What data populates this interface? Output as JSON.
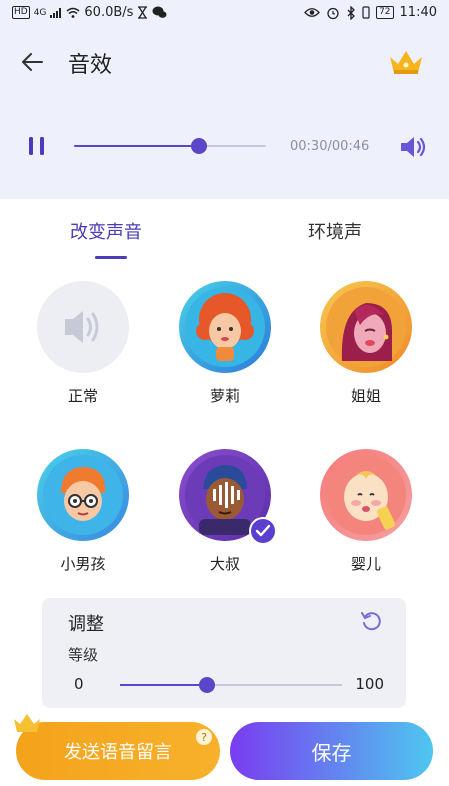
{
  "status_bar": {
    "hd": "HD",
    "network": "4G",
    "speed": "60.0B/s",
    "battery": "72",
    "time": "11:40"
  },
  "header": {
    "title": "音效"
  },
  "player": {
    "time": "00:30/00:46",
    "progress_fraction": 0.65
  },
  "tabs": [
    {
      "label": "改变声音",
      "active": true
    },
    {
      "label": "环境声",
      "active": false
    }
  ],
  "voices": [
    {
      "label": "正常",
      "selected": false
    },
    {
      "label": "萝莉",
      "selected": false
    },
    {
      "label": "姐姐",
      "selected": false
    },
    {
      "label": "小男孩",
      "selected": false
    },
    {
      "label": "大叔",
      "selected": true
    },
    {
      "label": "婴儿",
      "selected": false
    }
  ],
  "adjust": {
    "title": "调整",
    "level_label": "等级",
    "min": "0",
    "max": "100",
    "level_fraction": 0.39
  },
  "buttons": {
    "send": "发送语音留言",
    "help": "?",
    "save": "保存"
  },
  "colors": {
    "accent": "#5b45c9",
    "header_bg": "#eef0fb",
    "send_button": "#f4a51d",
    "save_gradient_start": "#7a3cf0",
    "save_gradient_end": "#4ec7ef"
  }
}
